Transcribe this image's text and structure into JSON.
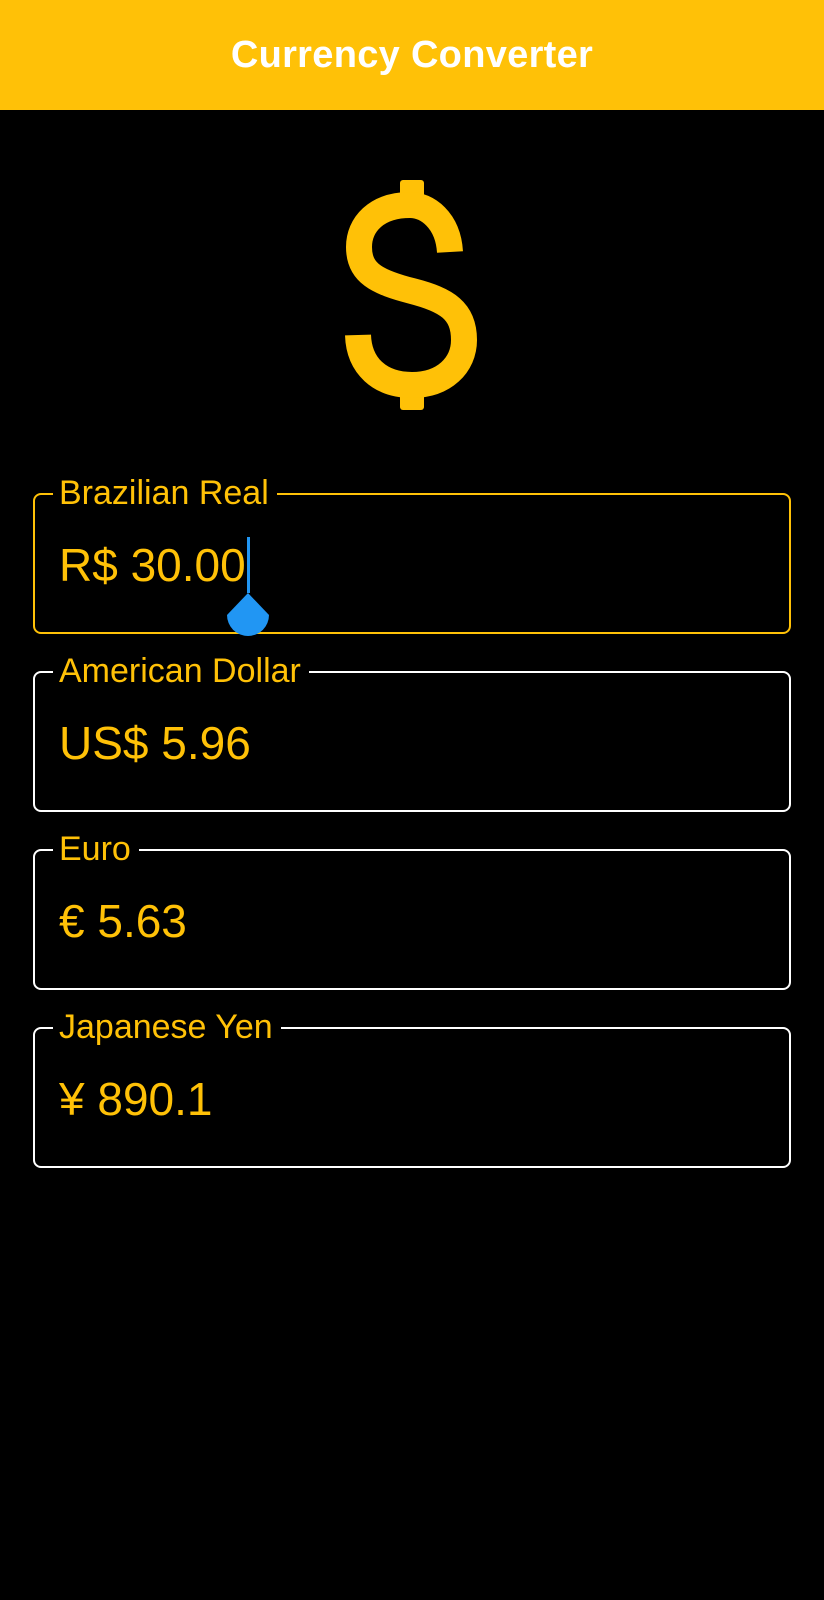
{
  "appbar": {
    "title": "Currency Converter",
    "color": "#FFC107"
  },
  "hero": {
    "icon": "dollar-sign-icon",
    "color": "#FFC107"
  },
  "fields": [
    {
      "key": "brl",
      "label": "Brazilian Real",
      "value": "R$ 30.00",
      "focused": true
    },
    {
      "key": "usd",
      "label": "American Dollar",
      "value": "US$ 5.96",
      "focused": false
    },
    {
      "key": "eur",
      "label": "Euro",
      "value": "€ 5.63",
      "focused": false
    },
    {
      "key": "jpy",
      "label": "Japanese Yen",
      "value": "¥ 890.1",
      "focused": false
    }
  ],
  "colors": {
    "background": "#000000",
    "accent": "#FFC107",
    "border": "#FFFFFF",
    "caret": "#2196F3"
  }
}
